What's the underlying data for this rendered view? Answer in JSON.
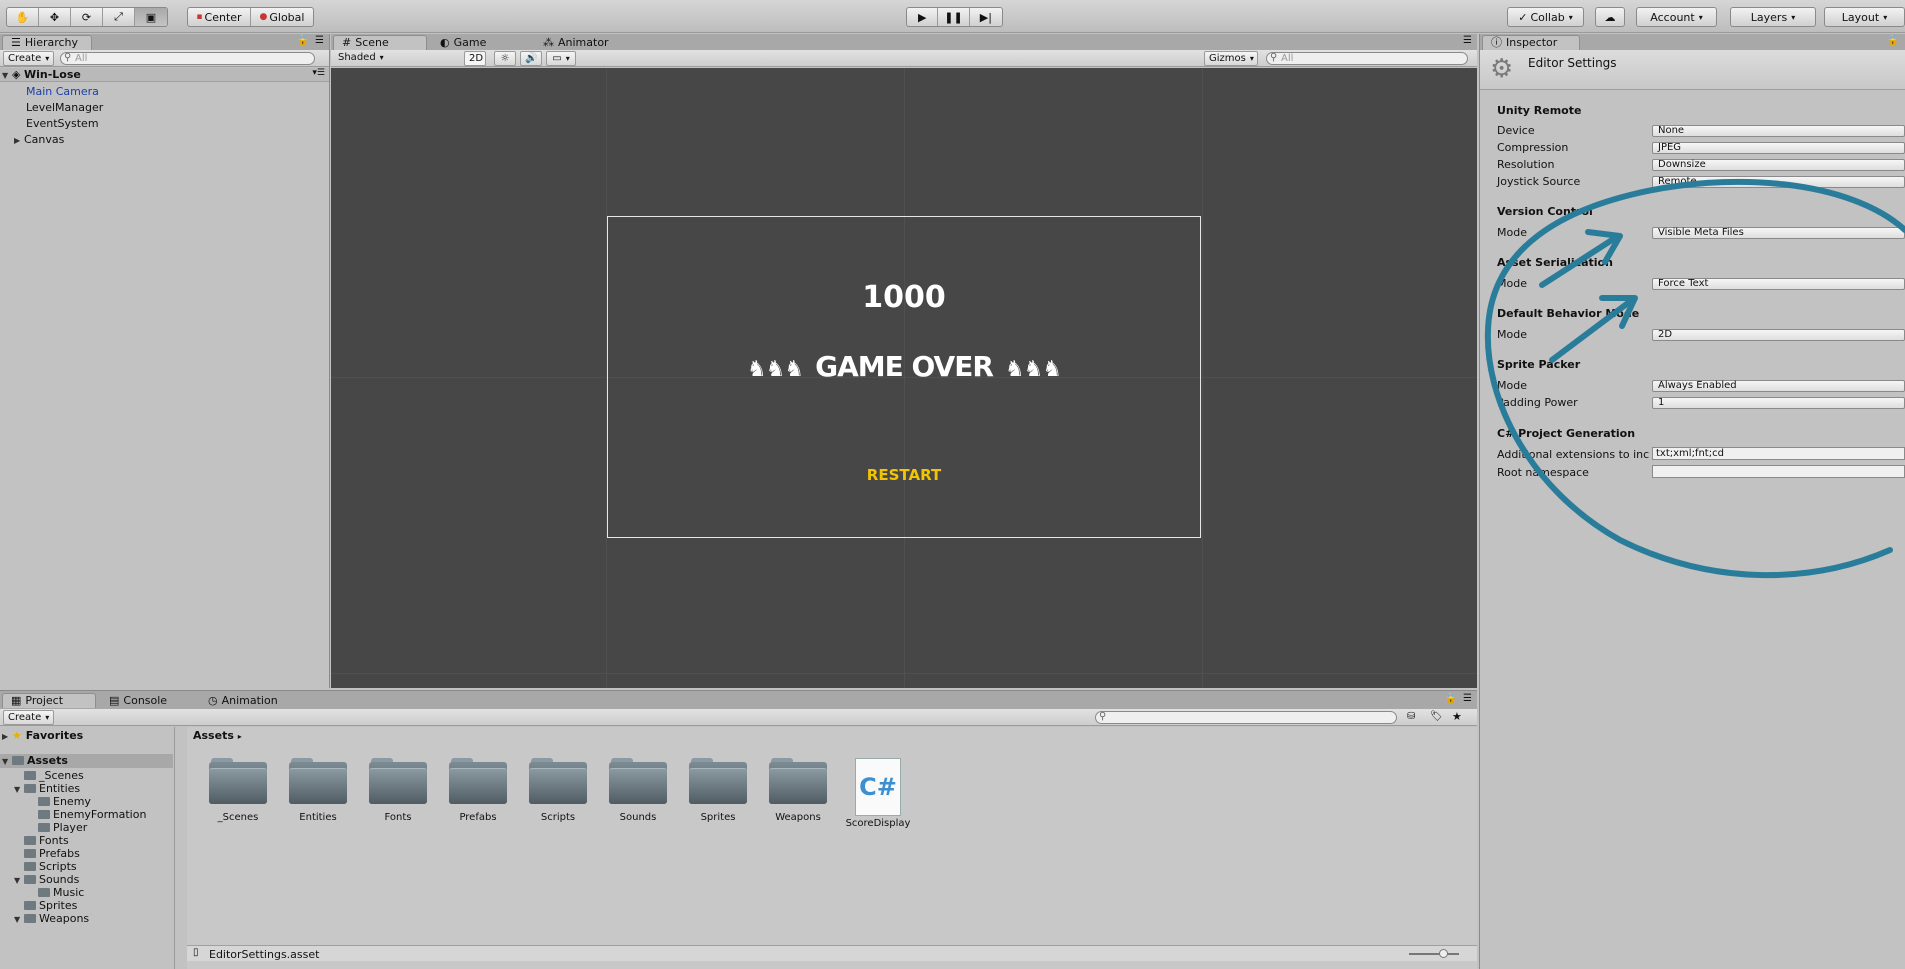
{
  "toolbar": {
    "tools": [
      "hand-tool",
      "move-tool",
      "rotate-tool",
      "scale-tool",
      "rect-tool"
    ],
    "pivot_label": "Center",
    "space_label": "Global",
    "collab_label": "Collab",
    "account_label": "Account",
    "layers_label": "Layers",
    "layout_label": "Layout"
  },
  "hierarchy": {
    "tab_label": "Hierarchy",
    "create_label": "Create",
    "search_placeholder": "All",
    "scene_name": "Win-Lose",
    "items": [
      "Main Camera",
      "LevelManager",
      "EventSystem",
      "Canvas"
    ]
  },
  "scene": {
    "tabs": [
      "Scene",
      "Game",
      "Animator"
    ],
    "shading_mode": "Shaded",
    "mode_2d": "2D",
    "gizmos_label": "Gizmos",
    "search_placeholder": "All",
    "score_text": "1000",
    "game_over_text": "GAME OVER",
    "restart_text": "RESTART"
  },
  "inspector": {
    "tab_label": "Inspector",
    "title": "Editor Settings",
    "sections": {
      "unity_remote": "Unity Remote",
      "version_control": "Version Control",
      "asset_serialization": "Asset Serialization",
      "default_behavior_mode": "Default Behavior Mode",
      "sprite_packer": "Sprite Packer",
      "cs_project_generation": "C# Project Generation"
    },
    "labels": {
      "device": "Device",
      "compression": "Compression",
      "resolution": "Resolution",
      "joystick_source": "Joystick Source",
      "mode": "Mode",
      "padding_power": "Padding Power",
      "additional_extensions": "Additional extensions to inc",
      "root_namespace": "Root namespace"
    },
    "values": {
      "device": "None",
      "compression": "JPEG",
      "resolution": "Downsize",
      "joystick_source": "Remote",
      "vc_mode": "Visible Meta Files",
      "serialization_mode": "Force Text",
      "behavior_mode": "2D",
      "packer_mode": "Always Enabled",
      "padding_power": "1",
      "additional_extensions": "txt;xml;fnt;cd",
      "root_namespace": ""
    }
  },
  "project": {
    "tabs": [
      "Project",
      "Console",
      "Animation"
    ],
    "create_label": "Create",
    "tree": {
      "favorites": "Favorites",
      "assets": "Assets",
      "items": [
        {
          "label": "_Scenes",
          "depth": 1
        },
        {
          "label": "Entities",
          "depth": 1
        },
        {
          "label": "Enemy",
          "depth": 2
        },
        {
          "label": "EnemyFormation",
          "depth": 2
        },
        {
          "label": "Player",
          "depth": 2
        },
        {
          "label": "Fonts",
          "depth": 1
        },
        {
          "label": "Prefabs",
          "depth": 1
        },
        {
          "label": "Scripts",
          "depth": 1
        },
        {
          "label": "Sounds",
          "depth": 1
        },
        {
          "label": "Music",
          "depth": 2
        },
        {
          "label": "Sprites",
          "depth": 1
        },
        {
          "label": "Weapons",
          "depth": 1
        }
      ]
    },
    "breadcrumb": "Assets",
    "assets": [
      "_Scenes",
      "Entities",
      "Fonts",
      "Prefabs",
      "Scripts",
      "Sounds",
      "Sprites",
      "Weapons",
      "ScoreDisplay"
    ],
    "status_file": "EditorSettings.asset"
  },
  "colors": {
    "annotation": "#2a7d9a",
    "restart": "#f2c500",
    "selected_item": "#1a3fa8"
  }
}
